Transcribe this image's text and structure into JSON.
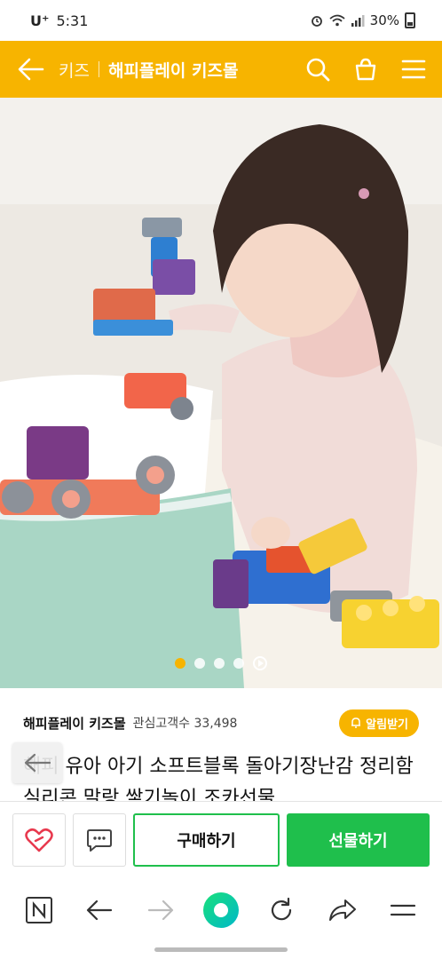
{
  "status_bar": {
    "carrier": "U⁺",
    "time": "5:31",
    "battery": "30%"
  },
  "header": {
    "breadcrumb": "키즈",
    "store_title": "해피플레이 키즈몰"
  },
  "gallery": {
    "current_slide": 1,
    "slide_count": 4
  },
  "store": {
    "name": "해피플레이 키즈몰",
    "followers_label": "관심고객수 33,498",
    "alert_label": "알림받기"
  },
  "product": {
    "title": "해피 유아 아기 소프트블록 돌아기장난감 정리함 실리콘 말랑 쌓기놀이 조카선물"
  },
  "actions": {
    "buy_label": "구매하기",
    "gift_label": "선물하기"
  },
  "colors": {
    "brand_yellow": "#f7b400",
    "naver_green": "#1fbf4c"
  }
}
